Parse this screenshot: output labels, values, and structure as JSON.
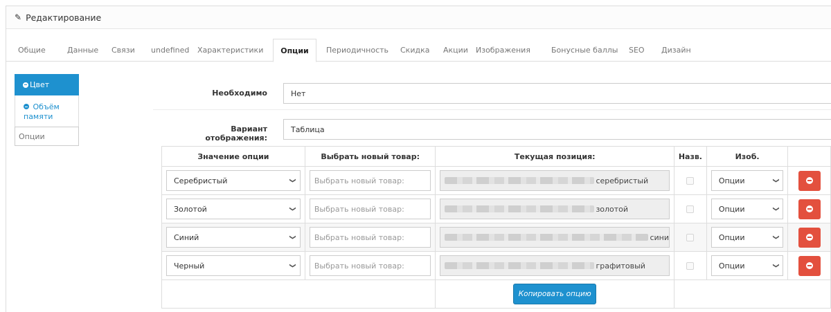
{
  "header": {
    "title": "Редактирование"
  },
  "tabs": [
    {
      "label": "Общие",
      "active": false
    },
    {
      "label": "Данные",
      "active": false
    },
    {
      "label": "Связи",
      "active": false
    },
    {
      "label": "undefined",
      "active": false
    },
    {
      "label": "Характеристики",
      "active": false
    },
    {
      "label": "Опции",
      "active": true
    },
    {
      "label": "Периодичность",
      "active": false
    },
    {
      "label": "Скидка",
      "active": false
    },
    {
      "label": "Акции",
      "active": false
    },
    {
      "label": "Изображения",
      "active": false
    },
    {
      "label": "Бонусные баллы",
      "active": false
    },
    {
      "label": "SEO",
      "active": false
    },
    {
      "label": "Дизайн",
      "active": false
    }
  ],
  "option_tabs": {
    "items": [
      {
        "label": "Цвет",
        "active": true
      },
      {
        "label": "Объём памяти",
        "active": false
      }
    ],
    "add_input_placeholder": "Опции"
  },
  "form": {
    "required_label": "Необходимо",
    "required_value": "Нет",
    "display_label": "Вариант отображения:",
    "display_value": "Таблица"
  },
  "table": {
    "headers": [
      "Значение опции",
      "Выбрать новый товар:",
      "Текущая позиция:",
      "Назв.",
      "Изоб.",
      ""
    ],
    "rows": [
      {
        "option_value": "Серебристый",
        "new_product_placeholder": "Выбрать новый товар:",
        "current_position_suffix": "серебристый",
        "image_select": "Опции"
      },
      {
        "option_value": "Золотой",
        "new_product_placeholder": "Выбрать новый товар:",
        "current_position_suffix": "золотой",
        "image_select": "Опции"
      },
      {
        "option_value": "Синий",
        "new_product_placeholder": "Выбрать новый товар:",
        "current_position_suffix": "сини",
        "image_select": "Опции"
      },
      {
        "option_value": "Черный",
        "new_product_placeholder": "Выбрать новый товар:",
        "current_position_suffix": "графитовый",
        "image_select": "Опции"
      }
    ],
    "copy_button": "Копировать опцию"
  },
  "colors": {
    "primary": "#1e91cf",
    "danger": "#e3503e"
  },
  "icons": {
    "header": "pencil-icon",
    "option_tab": "minus-circle-icon",
    "delete": "minus-circle-icon",
    "select": "chevron-down-icon"
  }
}
